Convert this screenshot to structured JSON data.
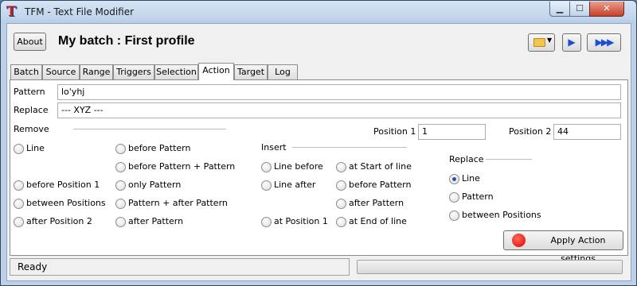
{
  "window": {
    "title": "TFM - Text File Modifier",
    "app_icon": "T"
  },
  "window_controls": {
    "minimize": "▁",
    "maximize": "☐",
    "close": "✕"
  },
  "header": {
    "about_label": "About",
    "batch_title": "My batch : First profile",
    "open_icon": "folder-open-icon",
    "run_icon": "▶",
    "run_all_icon": "▶▶▶"
  },
  "tabs": [
    {
      "label": "Batch"
    },
    {
      "label": "Source"
    },
    {
      "label": "Range"
    },
    {
      "label": "Triggers"
    },
    {
      "label": "Selection"
    },
    {
      "label": "Action",
      "active": true
    },
    {
      "label": "Target"
    },
    {
      "label": "Log"
    }
  ],
  "action": {
    "pattern_label": "Pattern",
    "pattern_value": "lo'yhj",
    "replace_label": "Replace",
    "replace_value": "--- XYZ ---",
    "position1_label": "Position 1",
    "position1_value": "1",
    "position2_label": "Position 2",
    "position2_value": "44",
    "remove_group": {
      "label": "Remove",
      "options": [
        "Line",
        "before Position 1",
        "between Positions",
        "after Position 2",
        "before Pattern",
        "before Pattern + Pattern",
        "only Pattern",
        "Pattern + after Pattern",
        "after Pattern"
      ]
    },
    "insert_group": {
      "label": "Insert",
      "options": [
        "Line before",
        "Line after",
        "at Position 1",
        "at Start of line",
        "before Pattern",
        "after Pattern",
        "at End of line"
      ]
    },
    "replace_group": {
      "label": "Replace",
      "options": [
        "Line",
        "Pattern",
        "between Positions"
      ],
      "selected": "Line"
    },
    "apply_label": "Apply Action settings",
    "apply_indicator_color": "#e00000"
  },
  "status": {
    "text": "Ready",
    "progress": 0.0
  }
}
